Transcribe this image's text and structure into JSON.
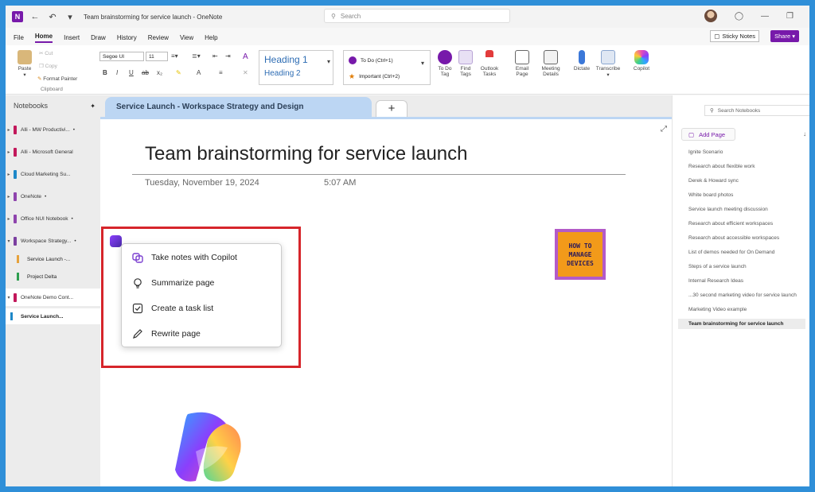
{
  "titlebar": {
    "logo": "N",
    "doc_title": "Team brainstorming for service launch  -  OneNote",
    "search_placeholder": "Search"
  },
  "menu_tabs": [
    "File",
    "Home",
    "Insert",
    "Draw",
    "History",
    "Review",
    "View",
    "Help"
  ],
  "actions": {
    "sticky_notes": "Sticky Notes",
    "share": "Share"
  },
  "ribbon": {
    "clipboard": {
      "paste": "Paste",
      "cut": "Cut",
      "copy": "Copy",
      "format_painter": "Format Painter",
      "group": "Clipboard"
    },
    "font": {
      "name": "Segoe UI",
      "size": "11"
    },
    "styles": {
      "h1": "Heading 1",
      "h2": "Heading 2"
    },
    "tags": {
      "todo": "To Do (Ctrl+1)",
      "important": "Important (Ctrl+2)"
    },
    "buttons": [
      {
        "l1": "To Do",
        "l2": "Tag"
      },
      {
        "l1": "Find",
        "l2": "Tags"
      },
      {
        "l1": "Outlook",
        "l2": "Tasks"
      },
      {
        "l1": "Email",
        "l2": "Page"
      },
      {
        "l1": "Meeting",
        "l2": "Details"
      },
      {
        "l1": "Dictate",
        "l2": ""
      },
      {
        "l1": "Transcribe",
        "l2": ""
      },
      {
        "l1": "Copilot",
        "l2": ""
      }
    ]
  },
  "sidebar": {
    "header": "Notebooks",
    "notebooks": [
      {
        "label": "Alli - MW Productivi...",
        "color": "#c2185b"
      },
      {
        "label": "Alli - Microsoft General",
        "color": "#c2185b"
      },
      {
        "label": "Cloud Marketing Su...",
        "color": "#1e88c8"
      },
      {
        "label": "OneNote",
        "color": "#8e44ad"
      },
      {
        "label": "Office NUI Notebook",
        "color": "#8e44ad"
      },
      {
        "label": "Workspace Strategy...",
        "color": "#7b3fa0"
      }
    ],
    "sections_a": [
      {
        "label": "Service Launch -...",
        "color": "#e6a23c"
      },
      {
        "label": "Project Delta",
        "color": "#2e9e4f"
      }
    ],
    "notebook_last": {
      "label": "OneNote Demo Cont...",
      "color": "#c2185b"
    },
    "section_last": {
      "label": "Service Launch...",
      "color": "#1e88c8"
    }
  },
  "section_tab": "Service Launch - Workspace Strategy and Design",
  "add_section": "+",
  "page": {
    "title": "Team brainstorming for service launch",
    "date": "Tuesday, November 19, 2024",
    "time": "5:07 AM"
  },
  "copilot_menu": [
    {
      "label": "Take notes with Copilot",
      "icon": "copilot-icon"
    },
    {
      "label": "Summarize page",
      "icon": "lightbulb-icon"
    },
    {
      "label": "Create a task list",
      "icon": "checkbox-icon"
    },
    {
      "label": "Rewrite page",
      "icon": "pencil-icon"
    }
  ],
  "watermark": {
    "l1": "HOW TO",
    "l2": "MANAGE",
    "l3": "DEVICES"
  },
  "right_panel": {
    "search_placeholder": "Search Notebooks",
    "add_page": "Add Page",
    "pages": [
      "Ignite Scenario",
      "Research about flexible work",
      "Derek & Howard sync",
      "White board photos",
      "Service launch meeting discussion",
      "Research about efficient workspaces",
      "Research about accessible workspaces",
      "List of demos needed for On Demand",
      "Steps of a service launch",
      "Internal Research Ideas",
      "...30 second marketing video for service launch",
      "Marketing Video example"
    ],
    "selected_page": "Team brainstorming for service launch"
  },
  "colors": {
    "accent": "#7719aa",
    "tab": "#bcd6f3",
    "highlight_box": "#d6252b"
  }
}
